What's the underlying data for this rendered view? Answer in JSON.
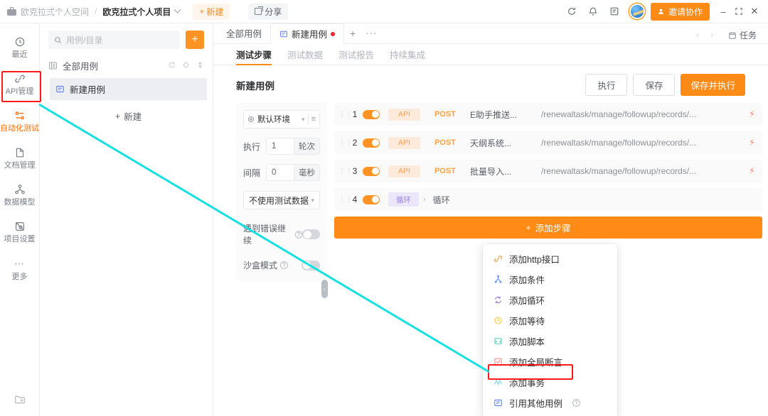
{
  "titlebar": {
    "workspace": "欧克拉弍个人空间",
    "separator": "/",
    "project": "欧克拉弍个人项目",
    "new_button": "新建",
    "share_button": "分享",
    "invite_button": "邀请协作",
    "icons": [
      "refresh-icon",
      "bell-icon",
      "notes-icon",
      "avatar"
    ],
    "window_controls": [
      "minimize",
      "maximize",
      "close"
    ]
  },
  "rail": {
    "items": [
      {
        "label": "最近",
        "icon": "clock-history-icon",
        "active": false
      },
      {
        "label": "API管理",
        "icon": "link-icon",
        "active": false
      },
      {
        "label": "自动化测试",
        "icon": "automation-icon",
        "active": true
      },
      {
        "label": "文档管理",
        "icon": "document-icon",
        "active": false
      },
      {
        "label": "数据模型",
        "icon": "data-model-icon",
        "active": false
      },
      {
        "label": "项目设置",
        "icon": "settings-icon",
        "active": false
      },
      {
        "label": "更多",
        "icon": "ellipsis-icon",
        "active": false
      }
    ],
    "bottom_icon": "add-folder-icon"
  },
  "tree": {
    "search_placeholder": "用例/目录",
    "add_button_label": "+",
    "root_label": "全部用例",
    "root_actions": [
      "refresh-icon",
      "filter-icon",
      "sort-icon"
    ],
    "nodes": [
      {
        "label": "新建用例",
        "icon": "case-icon",
        "selected": true
      }
    ],
    "add_label": "新建"
  },
  "tabs": {
    "items": [
      {
        "label": "全部用例",
        "active": false,
        "modified": false
      },
      {
        "label": "新建用例",
        "active": true,
        "modified": true
      }
    ],
    "plus": "+",
    "more": "···",
    "task_label": "任务",
    "prev": "‹",
    "next": "›"
  },
  "subtabs": {
    "items": [
      {
        "label": "测试步骤",
        "active": true
      },
      {
        "label": "测试数据",
        "active": false
      },
      {
        "label": "测试报告",
        "active": false
      },
      {
        "label": "持续集成",
        "active": false
      }
    ]
  },
  "case": {
    "title": "新建用例",
    "actions": [
      {
        "label": "执行",
        "primary": false
      },
      {
        "label": "保存",
        "primary": false
      },
      {
        "label": "保存并执行",
        "primary": true
      }
    ]
  },
  "config": {
    "environment": "默认环境",
    "exec_label": "执行",
    "exec_value": "1",
    "exec_unit": "轮次",
    "interval_label": "间隔",
    "interval_value": "0",
    "interval_unit": "毫秒",
    "dataset": "不使用测试数据",
    "toggles": [
      {
        "label": "遇到错误继续",
        "on": false
      },
      {
        "label": "沙盒模式",
        "on": false
      }
    ]
  },
  "steps": {
    "rows": [
      {
        "index": "1",
        "enabled": true,
        "type": "API",
        "type_style": "api",
        "method": "POST",
        "name": "E助手推送...",
        "url": "/renewaltask/manage/followup/records/...",
        "flash": "⚡"
      },
      {
        "index": "2",
        "enabled": true,
        "type": "API",
        "type_style": "api",
        "method": "POST",
        "name": "天纲系统...",
        "url": "/renewaltask/manage/followup/records/...",
        "flash": "⚡"
      },
      {
        "index": "3",
        "enabled": true,
        "type": "API",
        "type_style": "api",
        "method": "POST",
        "name": "批量导入...",
        "url": "/renewaltask/manage/followup/records/...",
        "flash": "⚡"
      },
      {
        "index": "4",
        "enabled": true,
        "type": "循环",
        "type_style": "loop",
        "method": "",
        "name": "循环",
        "url": "",
        "flash": ""
      }
    ],
    "add_label": "添加步骤"
  },
  "menu": {
    "items": [
      {
        "label": "添加http接口",
        "icon": "http-link-icon",
        "color": "#f79a3e",
        "help": false
      },
      {
        "label": "添加条件",
        "icon": "condition-branch-icon",
        "color": "#5b8ff9",
        "help": false
      },
      {
        "label": "添加循环",
        "icon": "loop-icon",
        "color": "#9b7fe0",
        "help": false
      },
      {
        "label": "添加等待",
        "icon": "clock-icon",
        "color": "#f7c948",
        "help": false
      },
      {
        "label": "添加脚本",
        "icon": "script-icon",
        "color": "#4dc9b0",
        "help": false
      },
      {
        "label": "添加全局断言",
        "icon": "assertion-icon",
        "color": "#f98080",
        "help": false
      },
      {
        "label": "添加事务",
        "icon": "transaction-icon",
        "color": "#7fd4f0",
        "help": false
      },
      {
        "label": "引用其他用例",
        "icon": "reference-case-icon",
        "color": "#5b7cfa",
        "help": true
      }
    ],
    "help_glyph": "?"
  },
  "annotations": {
    "highlight_color": "#ff1a1a",
    "line_color": "#19e0e0",
    "highlights": [
      "rail-item-automation",
      "menu-item-reference-case"
    ]
  }
}
